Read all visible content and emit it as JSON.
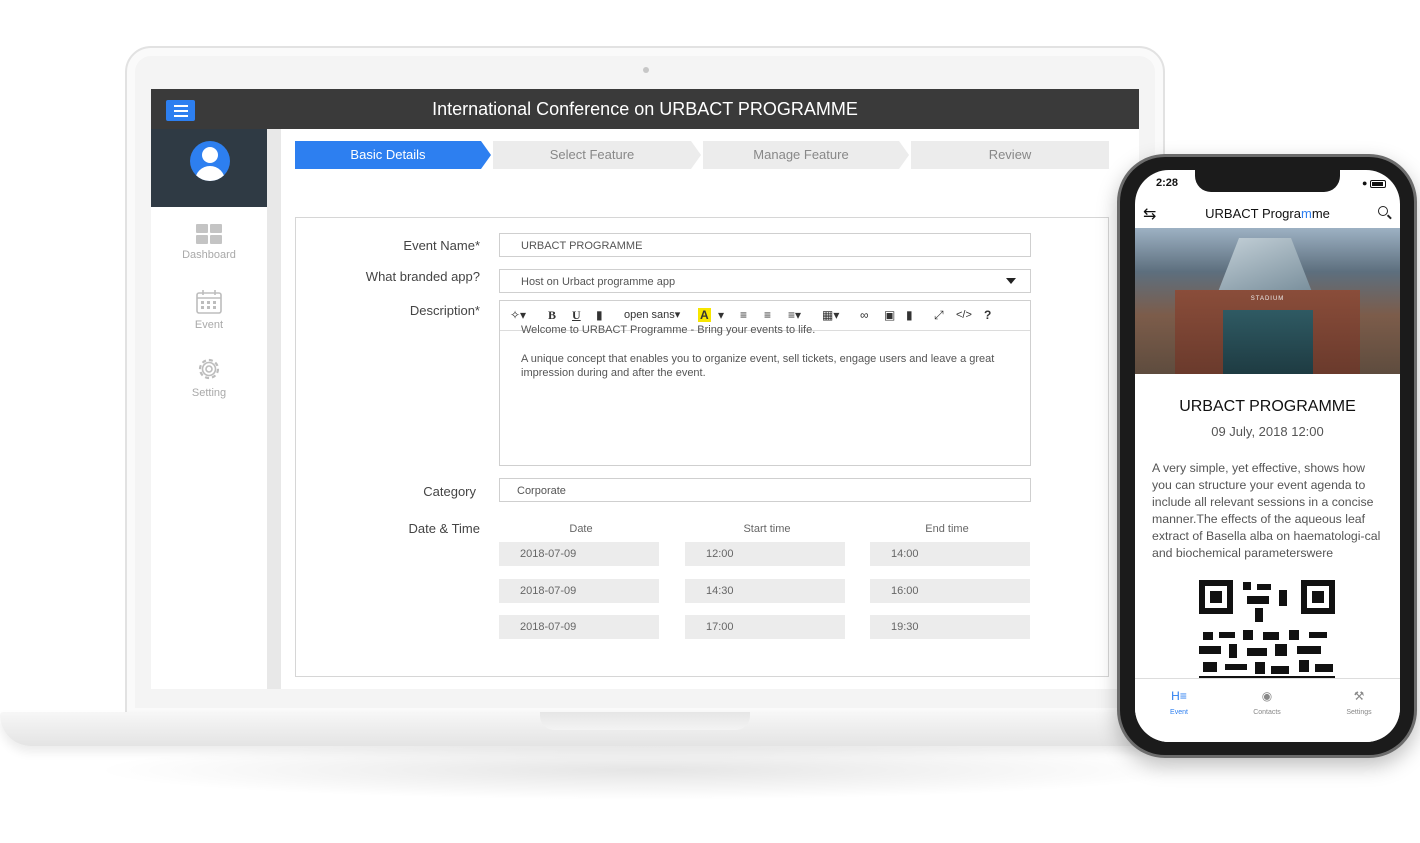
{
  "laptop": {
    "topbar": {
      "title": "International Conference on URBACT PROGRAMME"
    },
    "sidebar": {
      "items": [
        {
          "label": "Dashboard",
          "icon": "dashboard-icon"
        },
        {
          "label": "Event",
          "icon": "calendar-icon"
        },
        {
          "label": "Setting",
          "icon": "gear-icon"
        }
      ]
    },
    "steps": [
      {
        "label": "Basic Details",
        "active": true
      },
      {
        "label": "Select Feature",
        "active": false
      },
      {
        "label": "Manage Feature",
        "active": false
      },
      {
        "label": "Review",
        "active": false
      }
    ],
    "form": {
      "event_name": {
        "label": "Event Name*",
        "value": "URBACT PROGRAMME"
      },
      "branded_app": {
        "label": "What branded app?",
        "value": "Host on Urbact programme app"
      },
      "description": {
        "label": "Description*",
        "toolbar": {
          "font_select": "open sans"
        },
        "paragraph_1": "Welcome to URBACT Programme - Bring your events to life.",
        "paragraph_2": "A unique concept that enables you to organize event, sell tickets, engage users and leave a great impression during and after the event."
      },
      "category": {
        "label": "Category",
        "value": "Corporate"
      },
      "datetime": {
        "label": "Date & Time",
        "columns": [
          "Date",
          "Start time",
          "End time"
        ],
        "rows": [
          [
            "2018-07-09",
            "12:00",
            "14:00"
          ],
          [
            "2018-07-09",
            "14:30",
            "16:00"
          ],
          [
            "2018-07-09",
            "17:00",
            "19:30"
          ]
        ]
      }
    },
    "accent_color": "#2d7ff0",
    "topbar_color": "#3a3a3a",
    "sidebar_header_color": "#2f3a44"
  },
  "phone": {
    "status": {
      "time": "2:28"
    },
    "app_bar": {
      "title_pre": "URBACT Progra",
      "title_hl": "m",
      "title_post": "me"
    },
    "hero": {
      "stadium_label": "STADIUM"
    },
    "event": {
      "title": "URBACT PROGRAMME",
      "date": "09 July, 2018 12:00",
      "description": "A very simple, yet effective, shows how you can structure your event agenda to include all relevant sessions in a concise manner.The effects of the aqueous leaf extract of Basella alba on haematologi-cal and biochemical parameterswere"
    },
    "tabs": [
      {
        "label": "Event",
        "icon": "event-icon",
        "active": true
      },
      {
        "label": "Contacts",
        "icon": "contacts-icon",
        "active": false
      },
      {
        "label": "Settings",
        "icon": "tools-icon",
        "active": false
      }
    ]
  }
}
